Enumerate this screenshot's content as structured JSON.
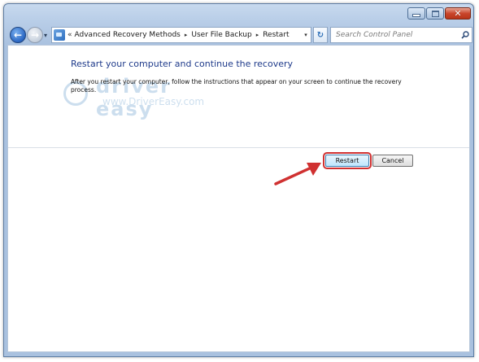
{
  "window": {
    "caption_buttons": {
      "minimize": "–",
      "maximize": "□",
      "close": "✕"
    }
  },
  "nav": {
    "back_icon": "←",
    "forward_icon": "→",
    "history_icon": "▾"
  },
  "address_bar": {
    "overflow_chevron": "«",
    "crumbs": [
      "Advanced Recovery Methods",
      "User File Backup",
      "Restart"
    ],
    "separator": "▸",
    "dropdown_icon": "▾"
  },
  "refresh_icon": "↻",
  "search": {
    "placeholder": "Search Control Panel"
  },
  "watermark": {
    "title": "driver easy",
    "url": "www.DriverEasy.com"
  },
  "main": {
    "title": "Restart your computer and continue the recovery",
    "description": "After you restart your computer, follow the instructions that appear on your screen to continue the recovery process."
  },
  "buttons": {
    "restart": "Restart",
    "cancel": "Cancel"
  },
  "colors": {
    "highlight": "#d03131",
    "title_text": "#1e3a8a",
    "frame": "#b9cee8"
  }
}
